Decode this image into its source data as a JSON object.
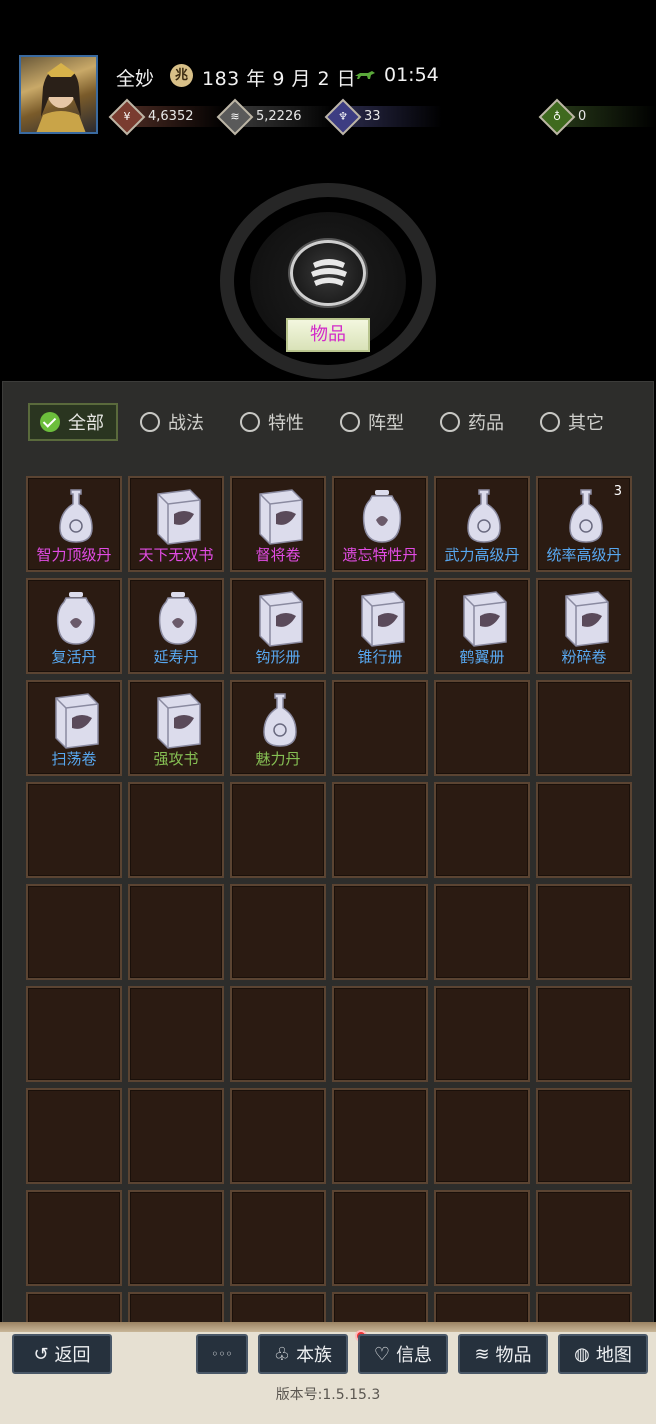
{
  "player": {
    "name": "全妙",
    "date": "183 年 9 月 2 日",
    "date_icon_glyph": "兆",
    "time": "01:54",
    "resources": [
      {
        "icon": "coin-icon",
        "value": "4,6352",
        "color": "#8a4b3a"
      },
      {
        "icon": "grain-icon",
        "value": "5,2226",
        "color": "#6a6a6a"
      },
      {
        "icon": "soldier-icon",
        "value": "33",
        "color": "#4a4a8a"
      },
      {
        "icon": "potion-icon",
        "value": "0",
        "color": "#4a7a2a"
      }
    ]
  },
  "page": {
    "title": "物品"
  },
  "tabs": [
    {
      "label": "全部",
      "active": true
    },
    {
      "label": "战法",
      "active": false
    },
    {
      "label": "特性",
      "active": false
    },
    {
      "label": "阵型",
      "active": false
    },
    {
      "label": "药品",
      "active": false
    },
    {
      "label": "其它",
      "active": false
    }
  ],
  "items": [
    {
      "label": "智力顶级丹",
      "type": "vase",
      "color": "pink",
      "count": ""
    },
    {
      "label": "天下无双书",
      "type": "book",
      "color": "pink",
      "count": ""
    },
    {
      "label": "督将卷",
      "type": "book",
      "color": "pink",
      "count": ""
    },
    {
      "label": "遗忘特性丹",
      "type": "jar",
      "color": "pink",
      "count": ""
    },
    {
      "label": "武力高级丹",
      "type": "vase",
      "color": "blue",
      "count": ""
    },
    {
      "label": "统率高级丹",
      "type": "vase",
      "color": "blue",
      "count": "3"
    },
    {
      "label": "复活丹",
      "type": "jar",
      "color": "blue",
      "count": ""
    },
    {
      "label": "延寿丹",
      "type": "jar",
      "color": "blue",
      "count": ""
    },
    {
      "label": "钩形册",
      "type": "book",
      "color": "blue",
      "count": ""
    },
    {
      "label": "锥行册",
      "type": "book",
      "color": "blue",
      "count": ""
    },
    {
      "label": "鹤翼册",
      "type": "book",
      "color": "blue",
      "count": ""
    },
    {
      "label": "粉碎卷",
      "type": "book",
      "color": "blue",
      "count": ""
    },
    {
      "label": "扫荡卷",
      "type": "book",
      "color": "blue",
      "count": ""
    },
    {
      "label": "强攻书",
      "type": "book",
      "color": "green",
      "count": ""
    },
    {
      "label": "魅力丹",
      "type": "vase",
      "color": "green",
      "count": ""
    }
  ],
  "bottom_bar": {
    "back": "返回",
    "more": "◦◦◦",
    "clan": "本族",
    "info": "信息",
    "items": "物品",
    "map": "地图"
  },
  "version": "版本号:1.5.15.3"
}
